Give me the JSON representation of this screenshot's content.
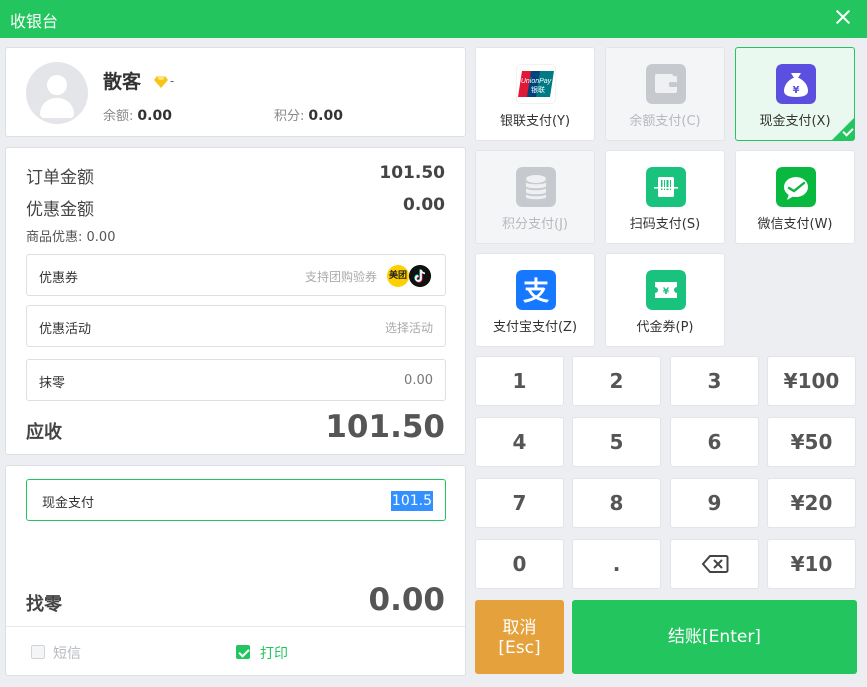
{
  "window": {
    "title": "收银台"
  },
  "customer": {
    "name": "散客",
    "level_suffix": "-",
    "balance_label": "余额:",
    "balance": "0.00",
    "points_label": "积分:",
    "points": "0.00"
  },
  "order": {
    "amount_label": "订单金额",
    "amount": "101.50",
    "discount_label": "优惠金额",
    "discount": "0.00",
    "goods_discount_label": "商品优惠:",
    "goods_discount": "0.00",
    "coupon_label": "优惠券",
    "coupon_placeholder": "支持团购验券",
    "meituan_badge": "美团",
    "activity_label": "优惠活动",
    "activity_placeholder": "选择活动",
    "rounding_label": "抹零",
    "rounding_value": "0.00",
    "due_label": "应收",
    "due": "101.50"
  },
  "payment": {
    "method_label": "现金支付",
    "input_value": "101.5",
    "change_label": "找零",
    "change": "0.00",
    "sms_label": "短信",
    "sms_checked": false,
    "print_label": "打印",
    "print_checked": true
  },
  "methods": [
    {
      "label": "银联支付(Y)",
      "icon": "unionpay-icon",
      "state": "normal"
    },
    {
      "label": "余额支付(C)",
      "icon": "wallet-icon",
      "state": "disabled"
    },
    {
      "label": "现金支付(X)",
      "icon": "cash-bag-icon",
      "state": "active"
    },
    {
      "label": "积分支付(J)",
      "icon": "coins-icon",
      "state": "disabled"
    },
    {
      "label": "扫码支付(S)",
      "icon": "scan-icon",
      "state": "normal"
    },
    {
      "label": "微信支付(W)",
      "icon": "wechat-icon",
      "state": "normal"
    },
    {
      "label": "支付宝支付(Z)",
      "icon": "alipay-icon",
      "state": "normal"
    },
    {
      "label": "代金券(P)",
      "icon": "voucher-icon",
      "state": "normal"
    }
  ],
  "unionpay": {
    "top": "UnionPay",
    "bottom": "银联"
  },
  "keypad": {
    "k1": "1",
    "k2": "2",
    "k3": "3",
    "k100": "¥100",
    "k4": "4",
    "k5": "5",
    "k6": "6",
    "k50": "¥50",
    "k7": "7",
    "k8": "8",
    "k9": "9",
    "k20": "¥20",
    "k0": "0",
    "kdot": ".",
    "k10": "¥10"
  },
  "actions": {
    "cancel_line1": "取消",
    "cancel_line2": "[Esc]",
    "checkout": "结账[Enter]"
  },
  "colors": {
    "accent": "#22c55e",
    "cancel": "#e5a13b",
    "selection": "#3390ff"
  }
}
